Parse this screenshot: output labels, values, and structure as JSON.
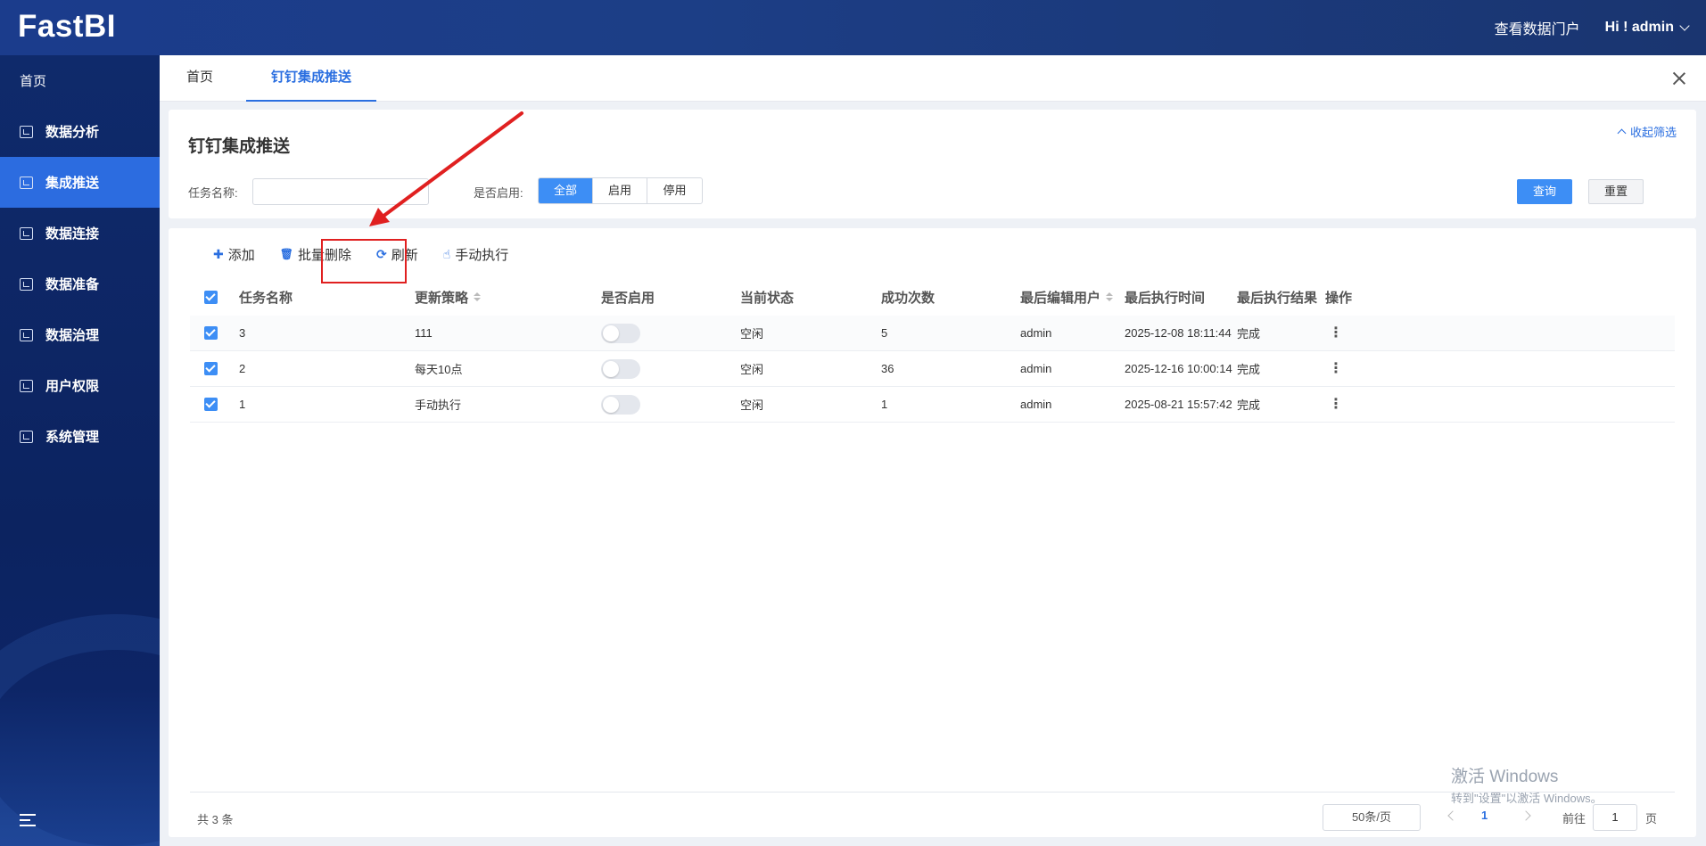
{
  "app": {
    "logo": "FastBI"
  },
  "header": {
    "portal_link": "查看数据门户",
    "user_greeting": "Hi ! admin"
  },
  "sidebar": {
    "home": "首页",
    "items": [
      {
        "label": "数据分析",
        "icon": "analysis-icon"
      },
      {
        "label": "集成推送",
        "icon": "push-icon",
        "active": true
      },
      {
        "label": "数据连接",
        "icon": "connect-icon"
      },
      {
        "label": "数据准备",
        "icon": "prepare-icon"
      },
      {
        "label": "数据治理",
        "icon": "govern-icon"
      },
      {
        "label": "用户权限",
        "icon": "permission-icon"
      },
      {
        "label": "系统管理",
        "icon": "system-icon"
      }
    ]
  },
  "tabs": [
    {
      "label": "首页"
    },
    {
      "label": "钉钉集成推送",
      "active": true
    }
  ],
  "filter": {
    "title": "钉钉集成推送",
    "collapse_label": "收起筛选",
    "task_name_label": "任务名称:",
    "task_name_value": "",
    "enabled_label": "是否启用:",
    "enabled_options": [
      "全部",
      "启用",
      "停用"
    ],
    "enabled_selected": "全部",
    "query_button": "查询",
    "reset_button": "重置"
  },
  "toolbar": {
    "add": "添加",
    "batch_delete": "批量删除",
    "refresh": "刷新",
    "manual_run": "手动执行"
  },
  "table": {
    "columns": [
      "任务名称",
      "更新策略",
      "是否启用",
      "当前状态",
      "成功次数",
      "最后编辑用户",
      "最后执行时间",
      "最后执行结果",
      "操作"
    ],
    "rows": [
      {
        "name": "3",
        "strategy": "111",
        "enabled": false,
        "status": "空闲",
        "success_count": "5",
        "editor": "admin",
        "last_run": "2025-12-08 18:11:44",
        "result": "完成",
        "checked": true
      },
      {
        "name": "2",
        "strategy": "每天10点",
        "enabled": false,
        "status": "空闲",
        "success_count": "36",
        "editor": "admin",
        "last_run": "2025-12-16 10:00:14",
        "result": "完成",
        "checked": true
      },
      {
        "name": "1",
        "strategy": "手动执行",
        "enabled": false,
        "status": "空闲",
        "success_count": "1",
        "editor": "admin",
        "last_run": "2025-08-21 15:57:42",
        "result": "完成",
        "checked": true
      }
    ]
  },
  "pagination": {
    "total": "共 3 条",
    "page_size": "50条/页",
    "current_page": "1",
    "goto_label": "前往",
    "goto_value": "1",
    "page_unit": "页"
  },
  "watermark": {
    "line1": "激活 Windows",
    "line2": "转到\"设置\"以激活 Windows。"
  },
  "colors": {
    "accent": "#3d8ef5",
    "sidebar_bg": "#0f2a6b",
    "highlight_box": "#e02020"
  }
}
